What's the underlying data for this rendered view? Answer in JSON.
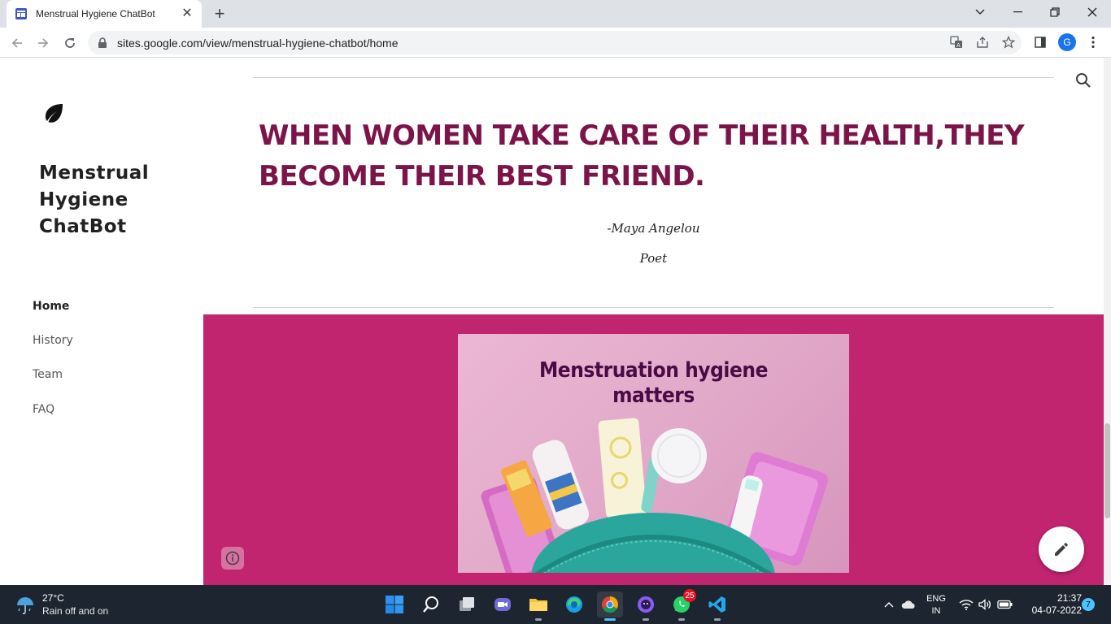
{
  "browser": {
    "tab_title": "Menstrual Hygiene ChatBot",
    "url": "sites.google.com/view/menstrual-hygiene-chatbot/home",
    "profile_initial": "G"
  },
  "site": {
    "title": "Menstrual Hygiene ChatBot",
    "nav": [
      {
        "label": "Home",
        "active": true
      },
      {
        "label": "History",
        "active": false
      },
      {
        "label": "Team",
        "active": false
      },
      {
        "label": "FAQ",
        "active": false
      }
    ]
  },
  "content": {
    "quote": "WHEN WOMEN TAKE CARE OF THEIR HEALTH,THEY BECOME THEIR BEST FRIEND.",
    "author": "-Maya Angelou",
    "role": "Poet",
    "hero_caption_line1": "Menstruation hygiene",
    "hero_caption_line2": "matters",
    "accent_color": "#c2256f",
    "quote_color": "#7b1448"
  },
  "taskbar": {
    "temperature": "27°C",
    "weather": "Rain off and on",
    "whatsapp_badge": "25",
    "lang_line1": "ENG",
    "lang_line2": "IN",
    "time": "21:37",
    "date": "04-07-2022",
    "notification_count": "7"
  }
}
